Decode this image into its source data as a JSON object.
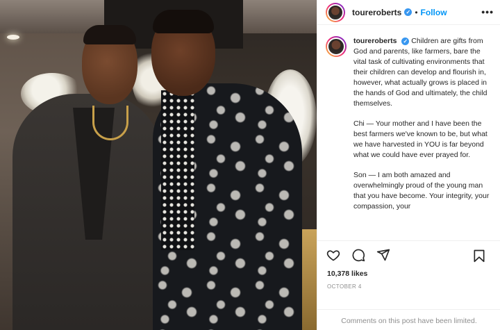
{
  "post": {
    "username": "toureroberts",
    "follow_label": "Follow",
    "separator": "•",
    "more_label": "•••",
    "caption_intro": "Children are gifts from God and parents, like farmers, bare the vital task of cultivating environments that their children can develop and flourish in, however, what actually grows is placed in the hands of God and ultimately, the child themselves.",
    "caption_para_2": "Chi — Your mother and I have been the best farmers we've known to be, but what we have harvested in YOU is far beyond what we could have ever prayed for.",
    "caption_para_3": "Son — I am both amazed and overwhelmingly proud of the young man that you have become. Your integrity, your compassion, your",
    "likes": "10,378 likes",
    "date": "OCTOBER 4",
    "comments_disabled": "Comments on this post have been limited."
  },
  "icons": {
    "like": "heart-icon",
    "comment": "comment-icon",
    "share": "share-icon",
    "save": "bookmark-icon",
    "verified": "verified-badge-icon"
  },
  "colors": {
    "accent": "#0095f6",
    "verified": "#3897f0",
    "muted": "#8e8e8e",
    "text": "#262626"
  }
}
